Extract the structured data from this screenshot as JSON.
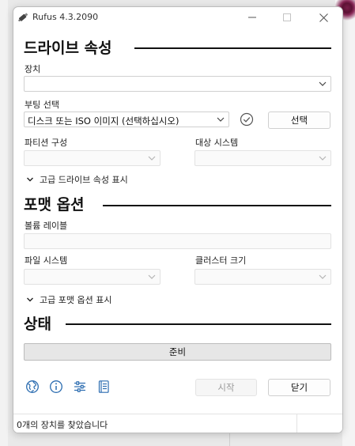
{
  "window": {
    "title": "Rufus 4.3.2090",
    "accent_color": "#2b6cb0"
  },
  "drive_properties": {
    "heading": "드라이브 속성",
    "device_label": "장치",
    "device_value": "",
    "boot_selection_label": "부팅 선택",
    "boot_selection_value": "디스크 또는 ISO 이미지 (선택하십시오)",
    "select_button": "선택",
    "partition_scheme_label": "파티션 구성",
    "partition_scheme_value": "",
    "target_system_label": "대상 시스템",
    "target_system_value": "",
    "advanced_toggle": "고급 드라이브 속성 표시"
  },
  "format_options": {
    "heading": "포맷 옵션",
    "volume_label_label": "볼륨 레이블",
    "volume_label_value": "",
    "file_system_label": "파일 시스템",
    "file_system_value": "",
    "cluster_size_label": "클러스터 크기",
    "cluster_size_value": "",
    "advanced_toggle": "고급 포맷 옵션 표시"
  },
  "status": {
    "heading": "상태",
    "progress_text": "준비",
    "progress_fraction": 0
  },
  "bottom": {
    "icons": [
      "globe-icon",
      "info-icon",
      "settings-sliders-icon",
      "log-icon"
    ],
    "start_button": "시작",
    "close_button": "닫기"
  },
  "statusbar": {
    "text": "0개의 장치를 찾았습니다"
  }
}
